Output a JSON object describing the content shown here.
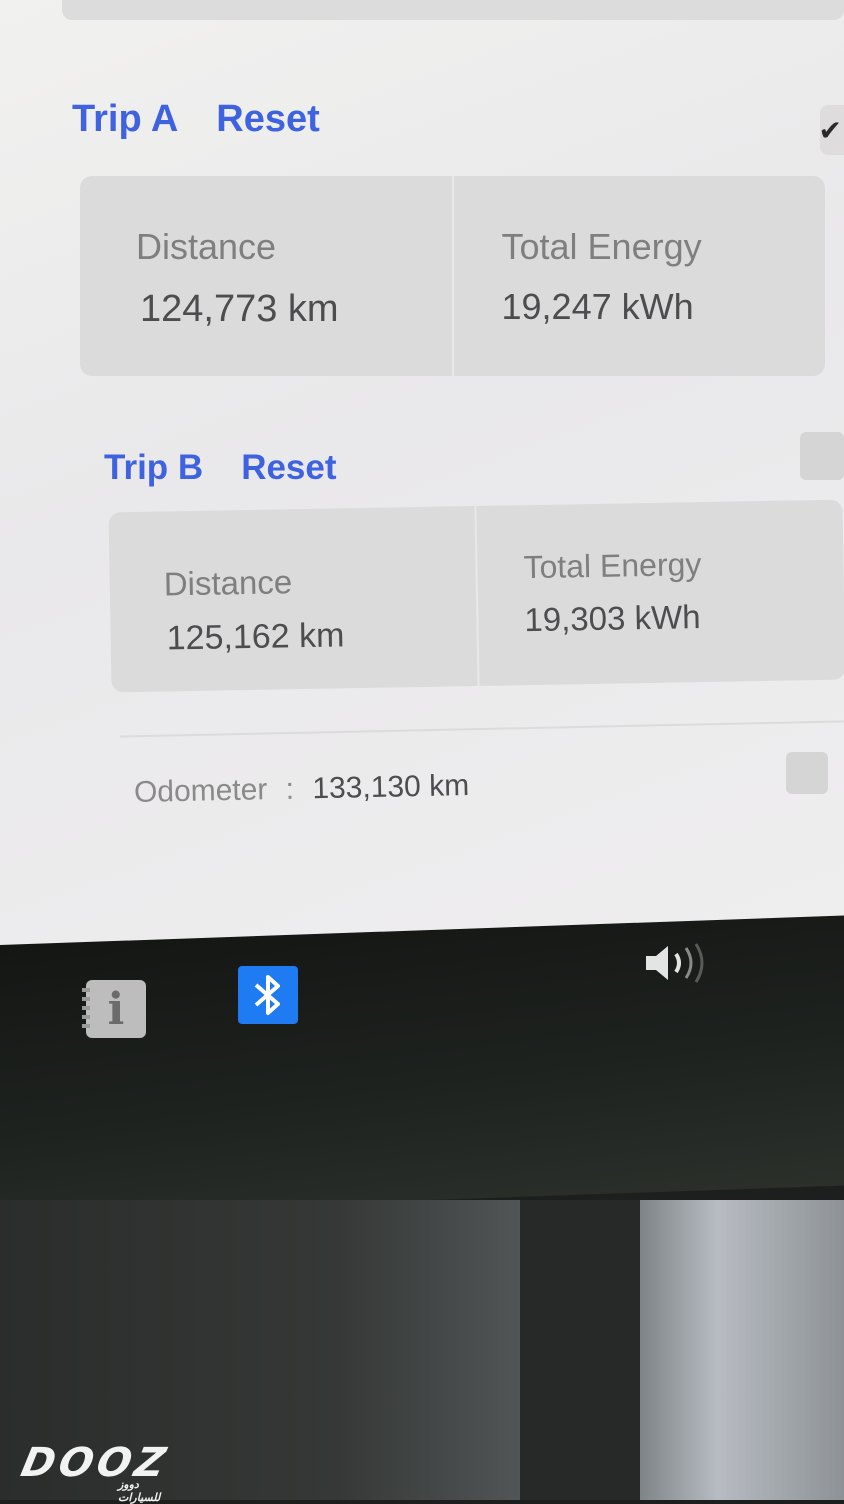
{
  "trips": [
    {
      "title": "Trip A",
      "reset_label": "Reset",
      "distance_label": "Distance",
      "distance_value": "124,773 km",
      "energy_label": "Total Energy",
      "energy_value": "19,247 kWh"
    },
    {
      "title": "Trip B",
      "reset_label": "Reset",
      "distance_label": "Distance",
      "distance_value": "125,162 km",
      "energy_label": "Total Energy",
      "energy_value": "19,303 kWh"
    }
  ],
  "odometer": {
    "label": "Odometer",
    "separator": ":",
    "value": "133,130 km"
  },
  "taskbar": {
    "info_icon": "i",
    "bluetooth_icon": "bluetooth-icon",
    "volume_icon": "volume-icon"
  },
  "watermark": {
    "brand": "DOOZ",
    "subtitle": "دووز للسيارات"
  },
  "colors": {
    "link_blue": "#3f63e0",
    "bluetooth_blue": "#1f7bf2"
  }
}
